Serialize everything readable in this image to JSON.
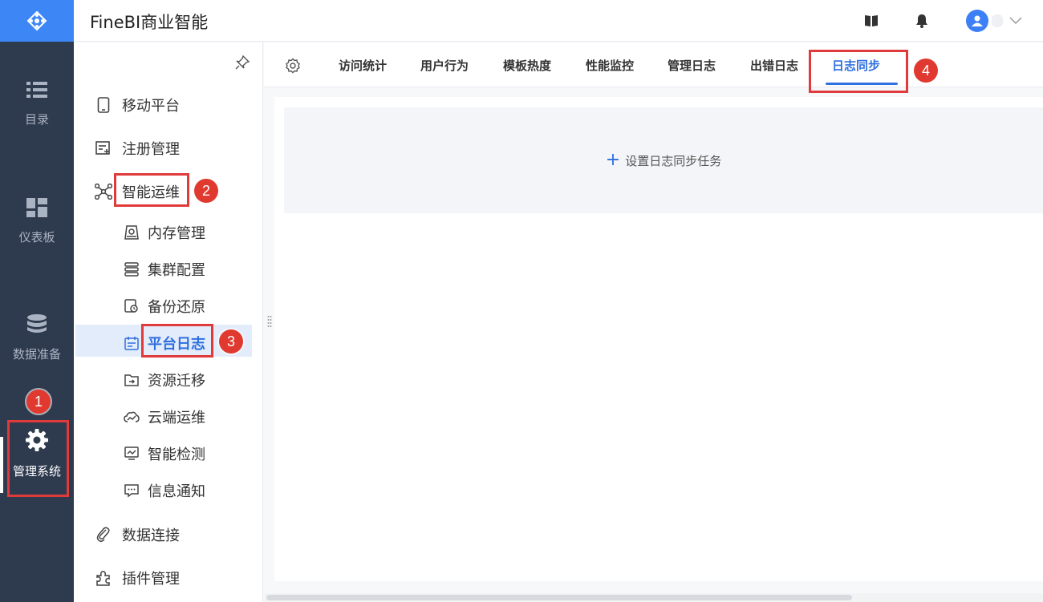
{
  "app": {
    "title": "FineBI商业智能"
  },
  "rail": {
    "items": [
      {
        "label": "目录",
        "icon": "list-icon"
      },
      {
        "label": "仪表板",
        "icon": "dashboard-icon"
      },
      {
        "label": "数据准备",
        "icon": "database-icon"
      },
      {
        "label": "管理系统",
        "icon": "gear-icon"
      }
    ]
  },
  "subnav": {
    "items": [
      {
        "label": "移动平台",
        "icon": "mobile-icon"
      },
      {
        "label": "注册管理",
        "icon": "register-icon"
      },
      {
        "label": "智能运维",
        "icon": "ops-icon"
      },
      {
        "label": "数据连接",
        "icon": "link-icon"
      },
      {
        "label": "插件管理",
        "icon": "plugin-icon"
      }
    ],
    "subitems": [
      {
        "label": "内存管理",
        "icon": "memory-icon"
      },
      {
        "label": "集群配置",
        "icon": "cluster-icon"
      },
      {
        "label": "备份还原",
        "icon": "backup-icon"
      },
      {
        "label": "平台日志",
        "icon": "log-icon"
      },
      {
        "label": "资源迁移",
        "icon": "migrate-icon"
      },
      {
        "label": "云端运维",
        "icon": "cloud-icon"
      },
      {
        "label": "智能检测",
        "icon": "monitor-icon"
      },
      {
        "label": "信息通知",
        "icon": "message-icon"
      }
    ],
    "selected": "平台日志"
  },
  "tabs": [
    {
      "label": "访问统计"
    },
    {
      "label": "用户行为"
    },
    {
      "label": "模板热度"
    },
    {
      "label": "性能监控"
    },
    {
      "label": "管理日志"
    },
    {
      "label": "出错日志"
    },
    {
      "label": "日志同步"
    }
  ],
  "active_tab": "日志同步",
  "content": {
    "add_task_label": "设置日志同步任务"
  },
  "annotations": {
    "badges": [
      "1",
      "2",
      "3",
      "4"
    ],
    "highlight_color": "#e03a3a"
  },
  "colors": {
    "accent": "#2f6fe0",
    "rail_bg": "#2e3a4e",
    "logo_bg": "#3d86f6"
  }
}
